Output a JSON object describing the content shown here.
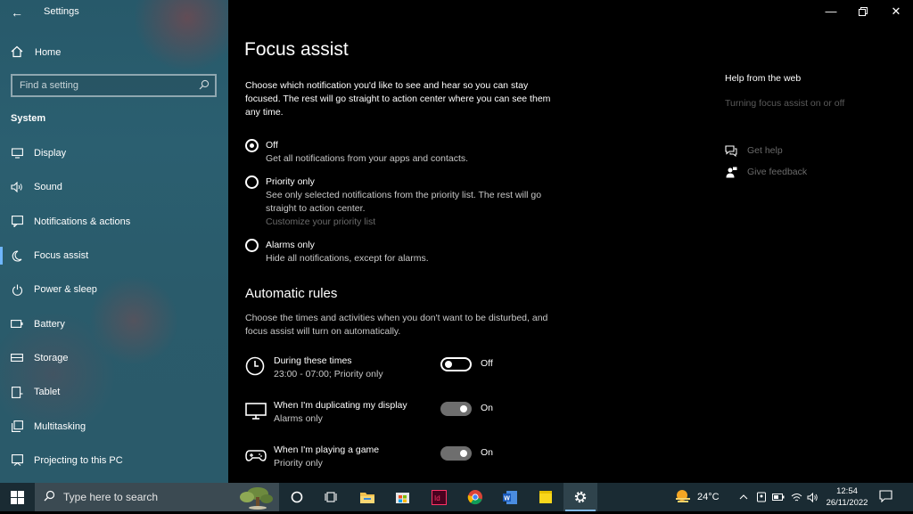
{
  "window": {
    "app_title": "Settings",
    "back_icon": "back-arrow-icon",
    "controls": [
      "minimize",
      "restore",
      "close"
    ]
  },
  "sidebar": {
    "home": "Home",
    "search_placeholder": "Find a setting",
    "section": "System",
    "items": [
      {
        "label": "Display",
        "icon": "display-icon"
      },
      {
        "label": "Sound",
        "icon": "sound-icon"
      },
      {
        "label": "Notifications & actions",
        "icon": "notifications-icon"
      },
      {
        "label": "Focus assist",
        "icon": "moon-icon",
        "active": true
      },
      {
        "label": "Power & sleep",
        "icon": "power-icon"
      },
      {
        "label": "Battery",
        "icon": "battery-icon"
      },
      {
        "label": "Storage",
        "icon": "storage-icon"
      },
      {
        "label": "Tablet",
        "icon": "tablet-icon"
      },
      {
        "label": "Multitasking",
        "icon": "multitasking-icon"
      },
      {
        "label": "Projecting to this PC",
        "icon": "projecting-icon"
      }
    ]
  },
  "main": {
    "title": "Focus assist",
    "description": "Choose which notification you'd like to see and hear so you can stay focused. The rest will go straight to action center where you can see them any time.",
    "options": [
      {
        "label": "Off",
        "desc": "Get all notifications from your apps and contacts.",
        "checked": true
      },
      {
        "label": "Priority only",
        "desc": "See only selected notifications from the priority list. The rest will go straight to action center.",
        "link": "Customize your priority list",
        "checked": false
      },
      {
        "label": "Alarms only",
        "desc": "Hide all notifications, except for alarms.",
        "checked": false
      }
    ],
    "rules_heading": "Automatic rules",
    "rules_description": "Choose the times and activities when you don't want to be disturbed, and focus assist will turn on automatically.",
    "rules": [
      {
        "title": "During these times",
        "sub": "23:00 - 07:00; Priority only",
        "state": "Off",
        "icon": "clock-icon"
      },
      {
        "title": "When I'm duplicating my display",
        "sub": "Alarms only",
        "state": "On",
        "icon": "monitor-icon"
      },
      {
        "title": "When I'm playing a game",
        "sub": "Priority only",
        "state": "On",
        "icon": "gamepad-icon"
      }
    ]
  },
  "help": {
    "title": "Help from the web",
    "link": "Turning focus assist on or off",
    "get_help": "Get help",
    "give_feedback": "Give feedback"
  },
  "taskbar": {
    "search_placeholder": "Type here to search",
    "weather": "24°C",
    "time": "12:54",
    "date": "26/11/2022",
    "accent": "#7fb8e5"
  }
}
